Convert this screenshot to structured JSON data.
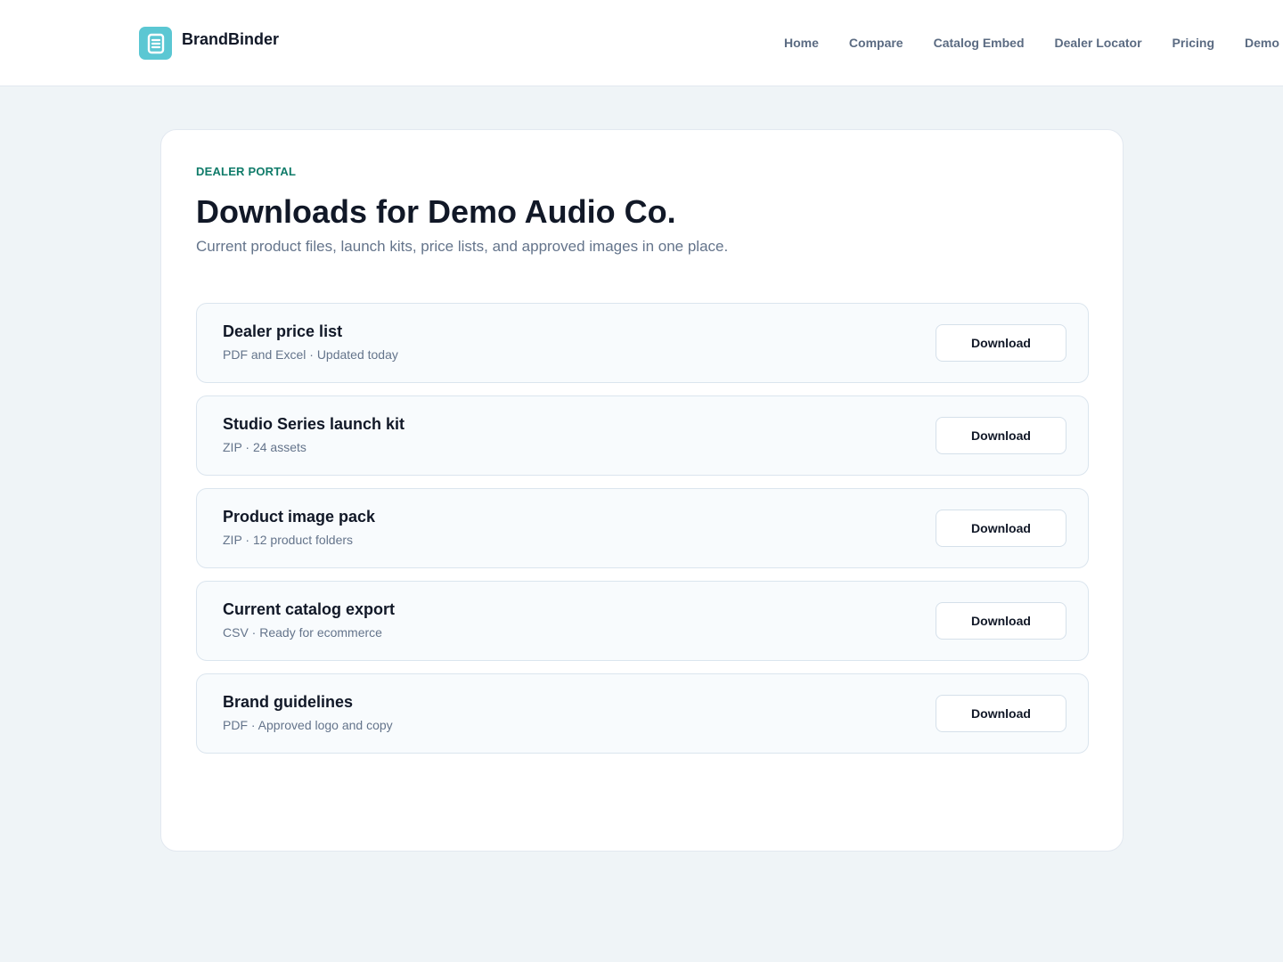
{
  "header": {
    "brand_name": "BrandBinder",
    "brand_icon": "document-list-icon",
    "nav": [
      {
        "label": "Home"
      },
      {
        "label": "Compare"
      },
      {
        "label": "Catalog Embed"
      },
      {
        "label": "Dealer Locator"
      },
      {
        "label": "Pricing"
      },
      {
        "label": "Demo"
      }
    ]
  },
  "main": {
    "eyebrow": "DEALER PORTAL",
    "title": "Downloads for Demo Audio Co.",
    "subtitle": "Current product files, launch kits, price lists, and approved images in one place.",
    "items": [
      {
        "title": "Dealer price list",
        "meta": "PDF and Excel · Updated today",
        "button": "Download"
      },
      {
        "title": "Studio Series launch kit",
        "meta": "ZIP · 24 assets",
        "button": "Download"
      },
      {
        "title": "Product image pack",
        "meta": "ZIP · 12 product folders",
        "button": "Download"
      },
      {
        "title": "Current catalog export",
        "meta": "CSV · Ready for ecommerce",
        "button": "Download"
      },
      {
        "title": "Brand guidelines",
        "meta": "PDF · Approved logo and copy",
        "button": "Download"
      }
    ]
  },
  "colors": {
    "page_background": "#eff4f7",
    "brand_accent": "#5bc7d3",
    "eyebrow": "#0f7b69",
    "text_primary": "#111827",
    "text_muted": "#64748b",
    "nav_text": "#5b6b82"
  }
}
